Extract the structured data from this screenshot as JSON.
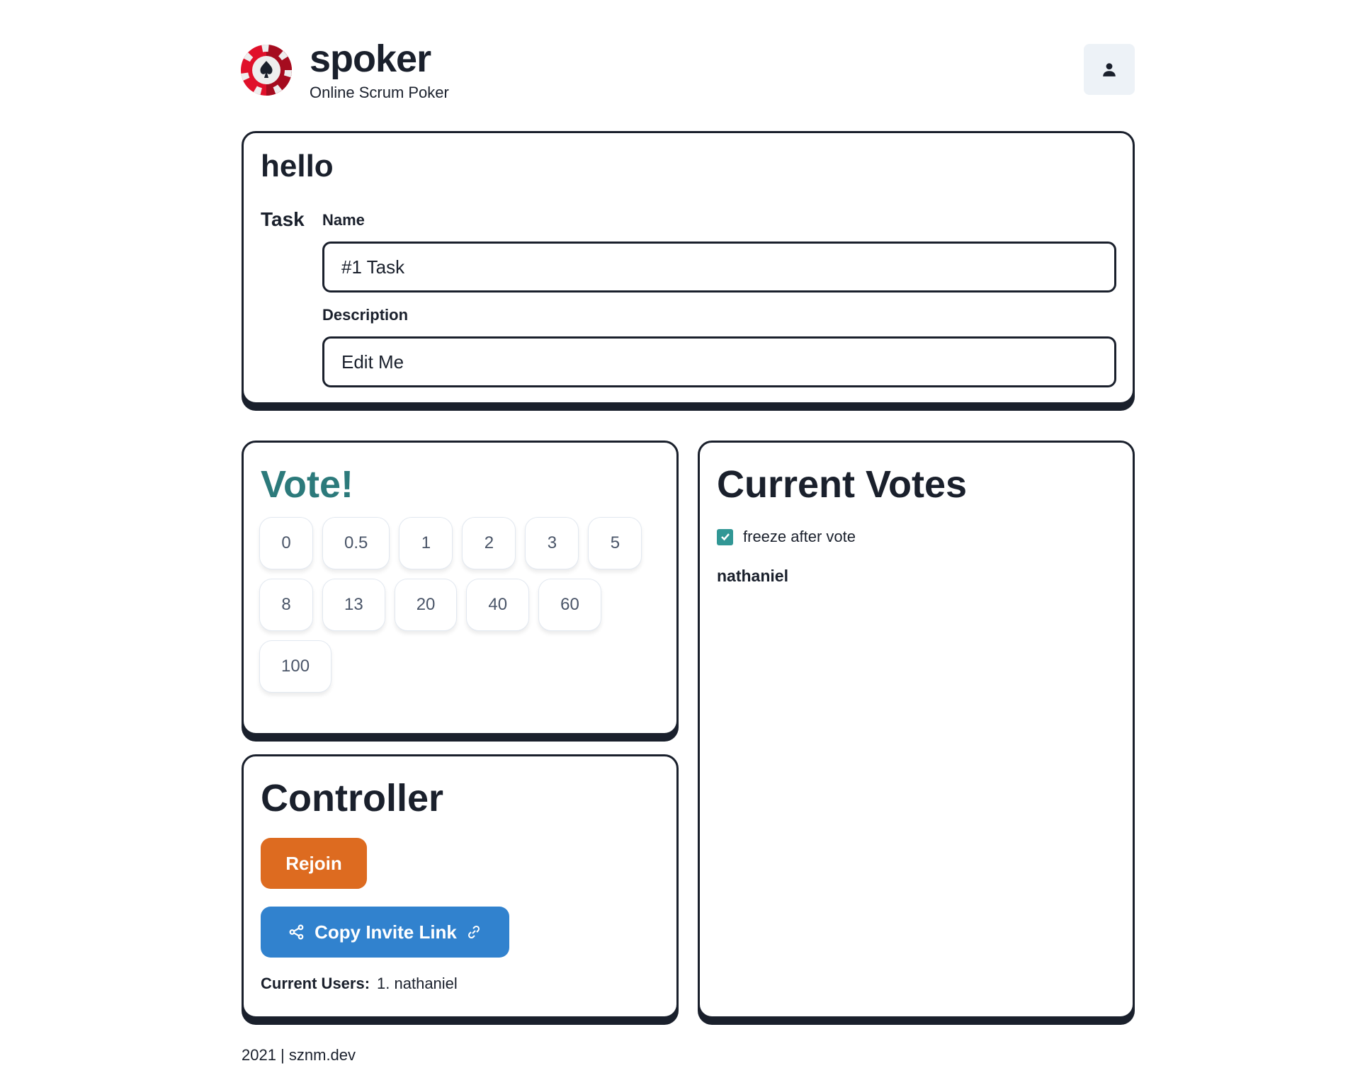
{
  "header": {
    "brand": "spoker",
    "tagline": "Online Scrum Poker",
    "logo_icon": "poker-chip-spade-icon",
    "user_icon": "user-icon"
  },
  "task": {
    "room_name": "hello",
    "section_label": "Task",
    "name_label": "Name",
    "name_value": "#1 Task",
    "description_label": "Description",
    "description_value": "Edit Me"
  },
  "vote": {
    "title": "Vote!",
    "title_color": "#2c7a7b",
    "options": [
      "0",
      "0.5",
      "1",
      "2",
      "3",
      "5",
      "8",
      "13",
      "20",
      "40",
      "60",
      "100"
    ]
  },
  "current_votes": {
    "title": "Current Votes",
    "freeze_label": "freeze after vote",
    "freeze_checked": true,
    "checkbox_color": "#319795",
    "voters": [
      "nathaniel"
    ]
  },
  "controller": {
    "title": "Controller",
    "rejoin_label": "Rejoin",
    "rejoin_color": "#dd6b20",
    "invite_label": "Copy Invite Link",
    "invite_color": "#3182ce",
    "users_label": "Current Users:",
    "users": [
      "1. nathaniel"
    ]
  },
  "footer": {
    "text": "2021 | sznm.dev"
  }
}
